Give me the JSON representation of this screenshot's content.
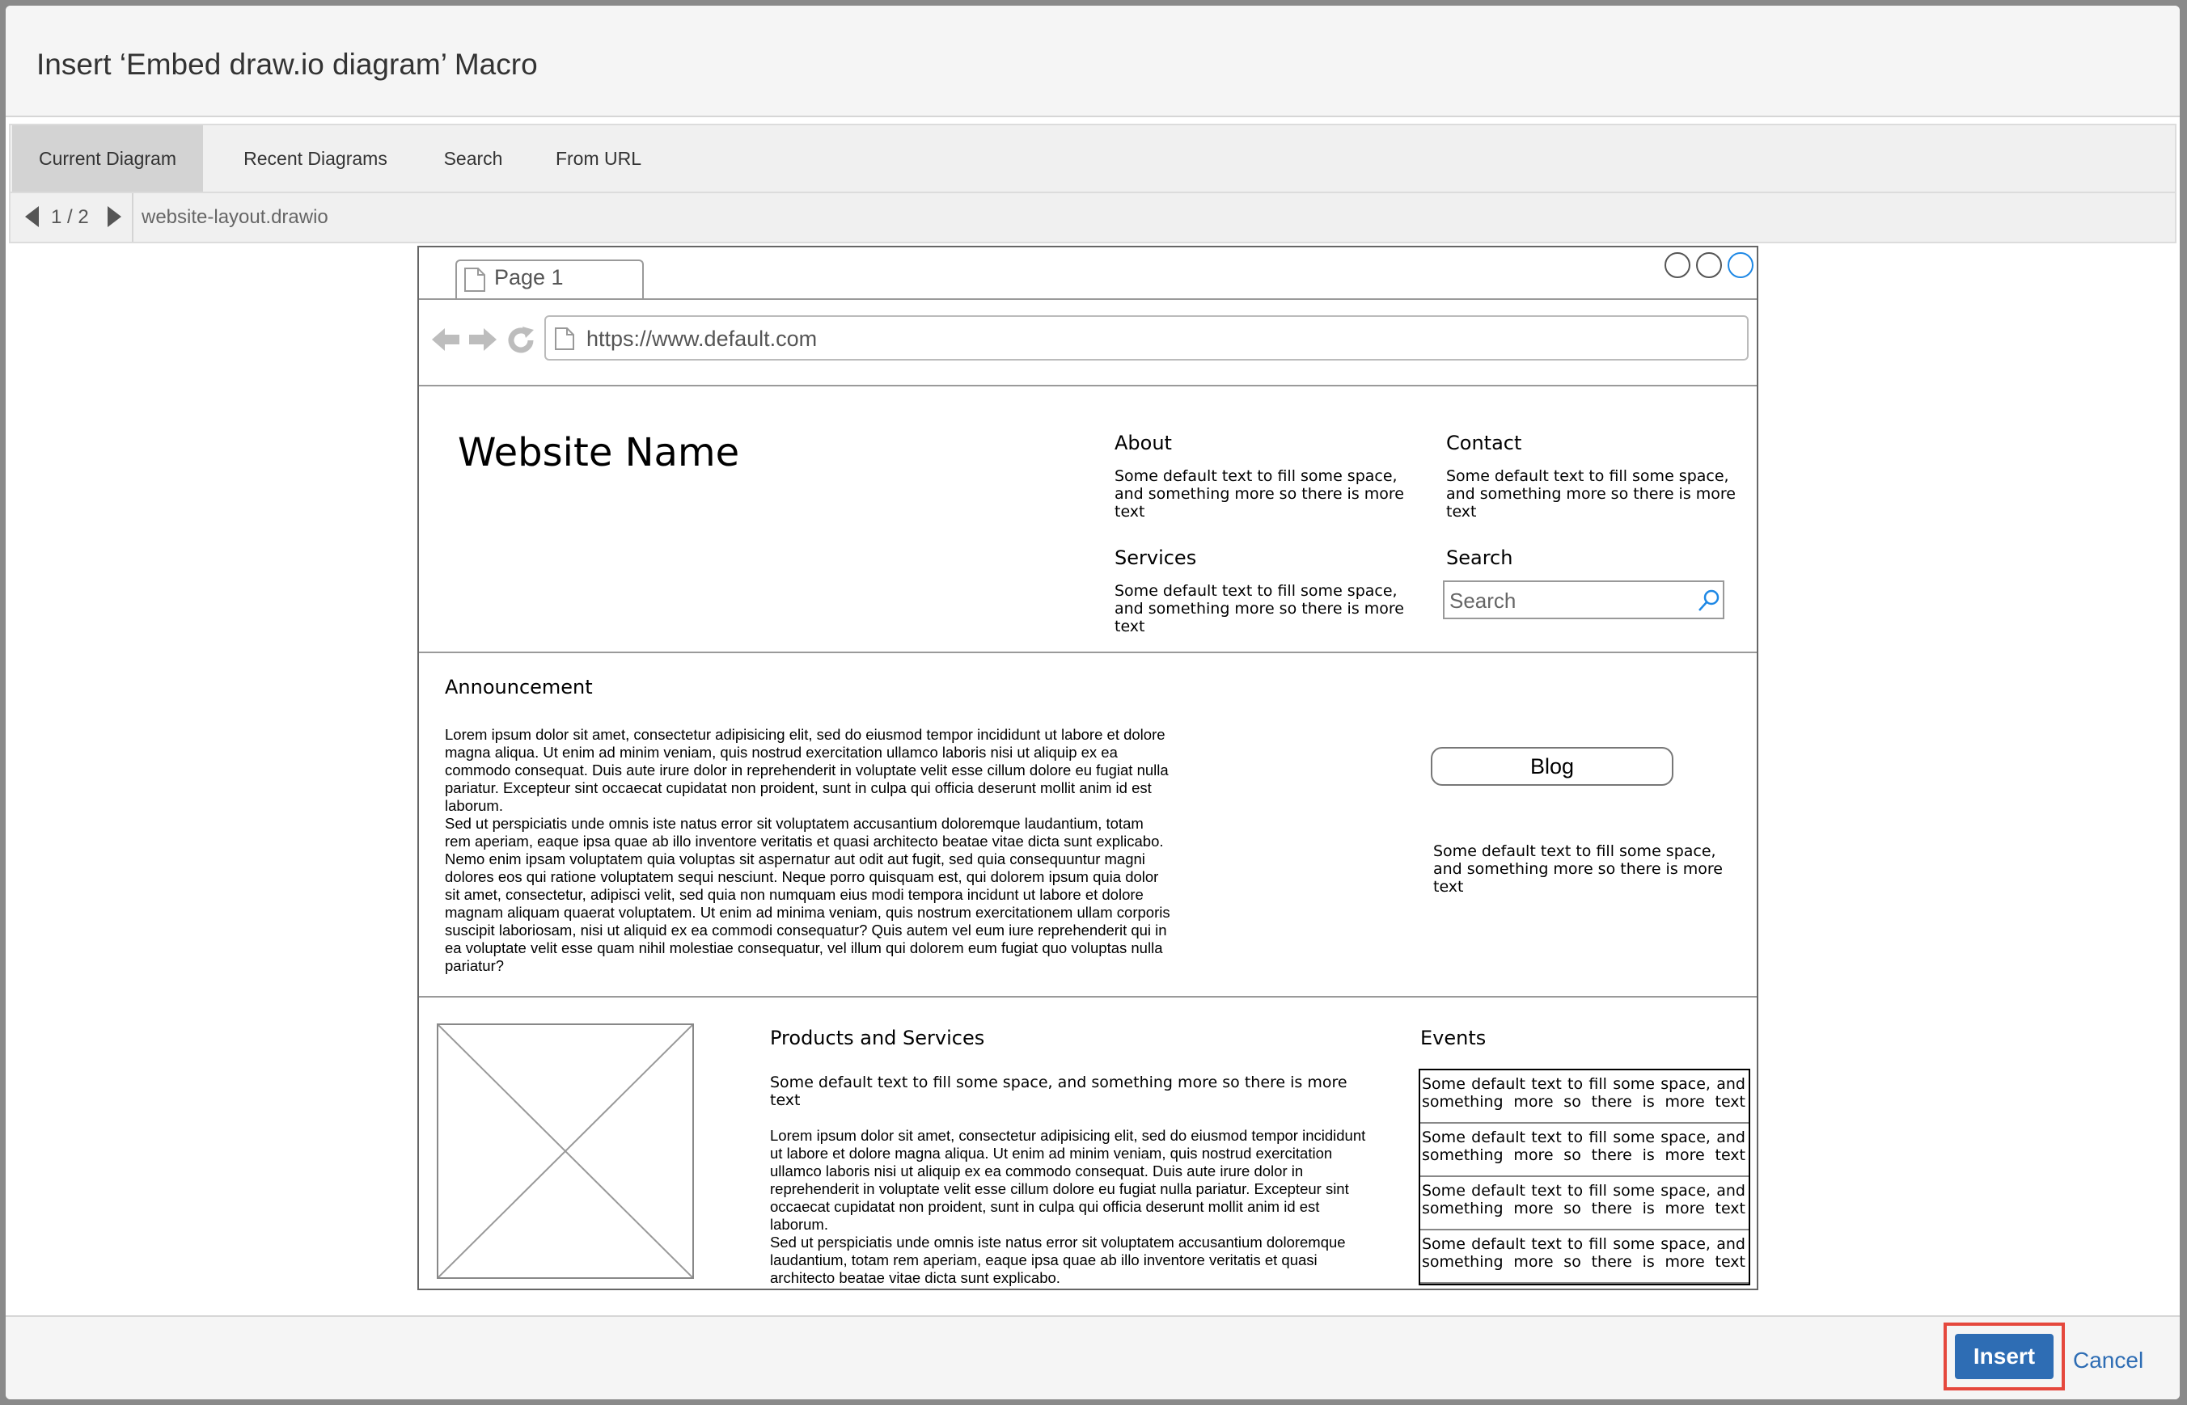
{
  "dialog": {
    "title": "Insert ‘Embed draw.io diagram’ Macro"
  },
  "tabs": [
    {
      "label": "Current Diagram",
      "active": true
    },
    {
      "label": "Recent Diagrams",
      "active": false
    },
    {
      "label": "Search",
      "active": false
    },
    {
      "label": "From URL",
      "active": false
    }
  ],
  "pager": {
    "count": "1 / 2",
    "filename": "website-layout.drawio"
  },
  "diagram": {
    "browser": {
      "tab_label": "Page 1",
      "url": "https://www.default.com"
    },
    "header": {
      "site_name": "Website Name",
      "about_title": "About",
      "about_text": "Some default text to fill some space, and something more so there is more text",
      "contact_title": "Contact",
      "contact_text": "Some default text to fill some space, and something more so there is more text",
      "services_title": "Services",
      "services_text": "Some default text to fill some space, and something more so there is more text",
      "search_title": "Search",
      "search_placeholder": "Search"
    },
    "announcement": {
      "title": "Announcement",
      "paragraph1": "Lorem ipsum dolor sit amet, consectetur adipisicing elit, sed do eiusmod tempor incididunt ut labore et dolore magna aliqua. Ut enim ad minim veniam, quis nostrud exercitation ullamco laboris nisi ut aliquip ex ea commodo consequat. Duis aute irure dolor in reprehenderit in voluptate velit esse cillum dolore eu fugiat nulla pariatur. Excepteur sint occaecat cupidatat non proident, sunt in culpa qui officia deserunt mollit anim id est laborum.",
      "paragraph2": "Sed ut perspiciatis unde omnis iste natus error sit voluptatem accusantium doloremque laudantium, totam rem aperiam, eaque ipsa quae ab illo inventore veritatis et quasi architecto beatae vitae dicta sunt explicabo. Nemo enim ipsam voluptatem quia voluptas sit aspernatur aut odit aut fugit, sed quia consequuntur magni dolores eos qui ratione voluptatem sequi nesciunt. Neque porro quisquam est, qui dolorem ipsum quia dolor sit amet, consectetur, adipisci velit, sed quia non numquam eius modi tempora incidunt ut labore et dolore magnam aliquam quaerat voluptatem. Ut enim ad minima veniam, quis nostrum exercitationem ullam corporis suscipit laboriosam, nisi ut aliquid ex ea commodi consequatur? Quis autem vel eum iure reprehenderit qui in ea voluptate velit esse quam nihil molestiae consequatur, vel illum qui dolorem eum fugiat quo voluptas nulla pariatur?",
      "blog_label": "Blog",
      "blog_text": "Some default text to fill some space, and something more so there is more text"
    },
    "products": {
      "title": "Products and Services",
      "intro": "Some default text to fill some space, and something more so there is more text",
      "paragraph1": "Lorem ipsum dolor sit amet, consectetur adipisicing elit, sed do eiusmod tempor incididunt ut labore et dolore magna aliqua. Ut enim ad minim veniam, quis nostrud exercitation ullamco laboris nisi ut aliquip ex ea commodo consequat. Duis aute irure dolor in reprehenderit in voluptate velit esse cillum dolore eu fugiat nulla pariatur. Excepteur sint occaecat cupidatat non proident, sunt in culpa qui officia deserunt mollit anim id est laborum.",
      "paragraph2": "Sed ut perspiciatis unde omnis iste natus error sit voluptatem accusantium doloremque laudantium, totam rem aperiam, eaque ipsa quae ab illo inventore veritatis et quasi architecto beatae vitae dicta sunt explicabo."
    },
    "events": {
      "title": "Events",
      "items": [
        "Some default text to fill some space, and something more so there is more text",
        "Some default text to fill some space, and something more so there is more text",
        "Some default text to fill some space, and something more so there is more text",
        "Some default text to fill some space, and something more so there is more text"
      ]
    }
  },
  "footer": {
    "insert_label": "Insert",
    "cancel_label": "Cancel"
  },
  "colors": {
    "primary": "#2e6db4",
    "highlight": "#e5483d",
    "accent_circle": "#1e88e5"
  }
}
